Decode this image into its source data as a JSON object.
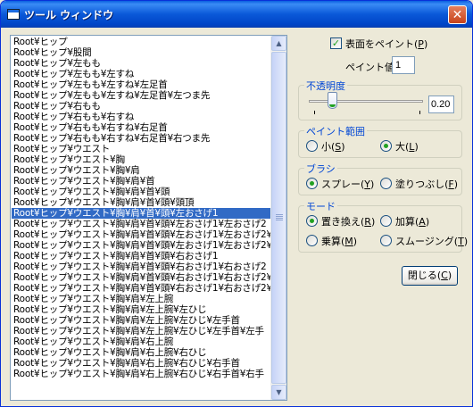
{
  "window": {
    "title": "ツール ウィンドウ",
    "close_glyph": "✕"
  },
  "tree_list": {
    "items": [
      "Root¥ヒップ",
      "Root¥ヒップ¥股間",
      "Root¥ヒップ¥左もも",
      "Root¥ヒップ¥左もも¥左すね",
      "Root¥ヒップ¥左もも¥左すね¥左足首",
      "Root¥ヒップ¥左もも¥左すね¥左足首¥左つま先",
      "Root¥ヒップ¥右もも",
      "Root¥ヒップ¥右もも¥右すね",
      "Root¥ヒップ¥右もも¥右すね¥右足首",
      "Root¥ヒップ¥右もも¥右すね¥右足首¥右つま先",
      "Root¥ヒップ¥ウエスト",
      "Root¥ヒップ¥ウエスト¥胸",
      "Root¥ヒップ¥ウエスト¥胸¥肩",
      "Root¥ヒップ¥ウエスト¥胸¥肩¥首",
      "Root¥ヒップ¥ウエスト¥胸¥肩¥首¥頭",
      "Root¥ヒップ¥ウエスト¥胸¥肩¥首¥頭¥頭頂",
      "Root¥ヒップ¥ウエスト¥胸¥肩¥首¥頭¥左おさげ1",
      "Root¥ヒップ¥ウエスト¥胸¥肩¥首¥頭¥左おさげ1¥左おさげ2",
      "Root¥ヒップ¥ウエスト¥胸¥肩¥首¥頭¥左おさげ1¥左おさげ2¥左",
      "Root¥ヒップ¥ウエスト¥胸¥肩¥首¥頭¥左おさげ1¥左おさげ2¥左",
      "Root¥ヒップ¥ウエスト¥胸¥肩¥首¥頭¥右おさげ1",
      "Root¥ヒップ¥ウエスト¥胸¥肩¥首¥頭¥右おさげ1¥右おさげ2",
      "Root¥ヒップ¥ウエスト¥胸¥肩¥首¥頭¥右おさげ1¥右おさげ2¥右",
      "Root¥ヒップ¥ウエスト¥胸¥肩¥首¥頭¥右おさげ1¥右おさげ2¥右",
      "Root¥ヒップ¥ウエスト¥胸¥肩¥左上腕",
      "Root¥ヒップ¥ウエスト¥胸¥肩¥左上腕¥左ひじ",
      "Root¥ヒップ¥ウエスト¥胸¥肩¥左上腕¥左ひじ¥左手首",
      "Root¥ヒップ¥ウエスト¥胸¥肩¥左上腕¥左ひじ¥左手首¥左手",
      "Root¥ヒップ¥ウエスト¥胸¥肩¥右上腕",
      "Root¥ヒップ¥ウエスト¥胸¥肩¥右上腕¥右ひじ",
      "Root¥ヒップ¥ウエスト¥胸¥肩¥右上腕¥右ひじ¥右手首",
      "Root¥ヒップ¥ウエスト¥胸¥肩¥右上腕¥右ひじ¥右手首¥右手"
    ],
    "selected_index": 16
  },
  "paint_surface": {
    "label_pre": "表面をペイント(",
    "key": "P",
    "label_post": ")",
    "checked": true
  },
  "paint_value": {
    "label": "ペイント値",
    "value": "1"
  },
  "opacity": {
    "legend": "不透明度",
    "value": "0.20",
    "level": 0.2
  },
  "paint_range": {
    "legend": "ペイント範囲",
    "small": {
      "pre": "小(",
      "key": "S",
      "post": ")",
      "selected": false
    },
    "large": {
      "pre": "大(",
      "key": "L",
      "post": ")",
      "selected": true
    }
  },
  "brush": {
    "legend": "ブラシ",
    "spray": {
      "pre": "スプレー(",
      "key": "Y",
      "post": ")",
      "selected": true
    },
    "fill": {
      "pre": "塗りつぶし(",
      "key": "F",
      "post": ")",
      "selected": false
    }
  },
  "mode": {
    "legend": "モード",
    "replace": {
      "pre": "置き換え(",
      "key": "R",
      "post": ")",
      "selected": true
    },
    "add": {
      "pre": "加算(",
      "key": "A",
      "post": ")",
      "selected": false
    },
    "multiply": {
      "pre": "乗算(",
      "key": "M",
      "post": ")",
      "selected": false
    },
    "smoothing": {
      "pre": "スムージング(",
      "key": "T",
      "post": ")",
      "selected": false
    }
  },
  "close_button": {
    "pre": "閉じる(",
    "key": "C",
    "post": ")"
  },
  "scrollbar": {
    "up_glyph": "▲",
    "down_glyph": "▼"
  },
  "colors": {
    "selection": "#316AC5",
    "titlebar": "#0A58D8",
    "group_legend": "#0046D5",
    "face": "#ECE9D8"
  }
}
